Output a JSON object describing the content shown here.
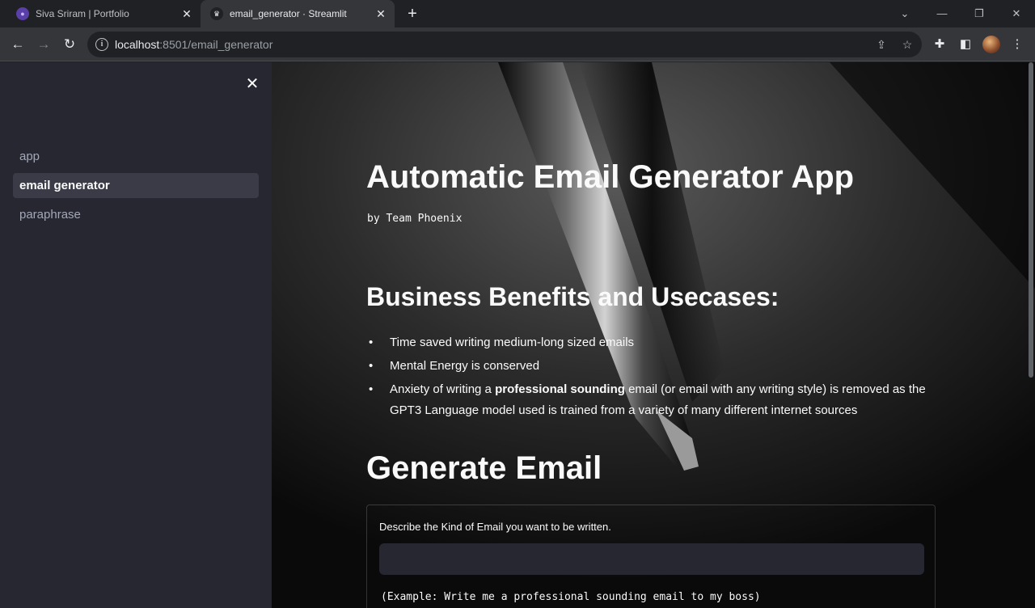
{
  "browser": {
    "tabs": [
      {
        "title": "Siva Sriram | Portfolio",
        "close": "✕"
      },
      {
        "title": "email_generator · Streamlit",
        "close": "✕"
      }
    ],
    "new_tab": "+",
    "url_host": "localhost",
    "url_rest": ":8501/email_generator"
  },
  "sidebar": {
    "close": "✕",
    "items": [
      {
        "label": "app"
      },
      {
        "label": "email generator"
      },
      {
        "label": "paraphrase"
      }
    ]
  },
  "main": {
    "title": "Automatic Email Generator App",
    "byline": "by Team Phoenix",
    "benefits_title": "Business Benefits and Usecases:",
    "benefits": [
      {
        "text": "Time saved writing medium-long sized emails"
      },
      {
        "text": "Mental Energy is conserved"
      },
      {
        "pre": "Anxiety of writing a ",
        "bold": "professional sounding",
        "post": " email (or email with any writing style) is removed as the GPT3 Language model used is trained from a variety of many different internet sources"
      }
    ],
    "generate_title": "Generate Email",
    "form": {
      "label": "Describe the Kind of Email you want to be written.",
      "input_value": "",
      "example": "(Example: Write me a professional sounding email to my boss)"
    }
  }
}
